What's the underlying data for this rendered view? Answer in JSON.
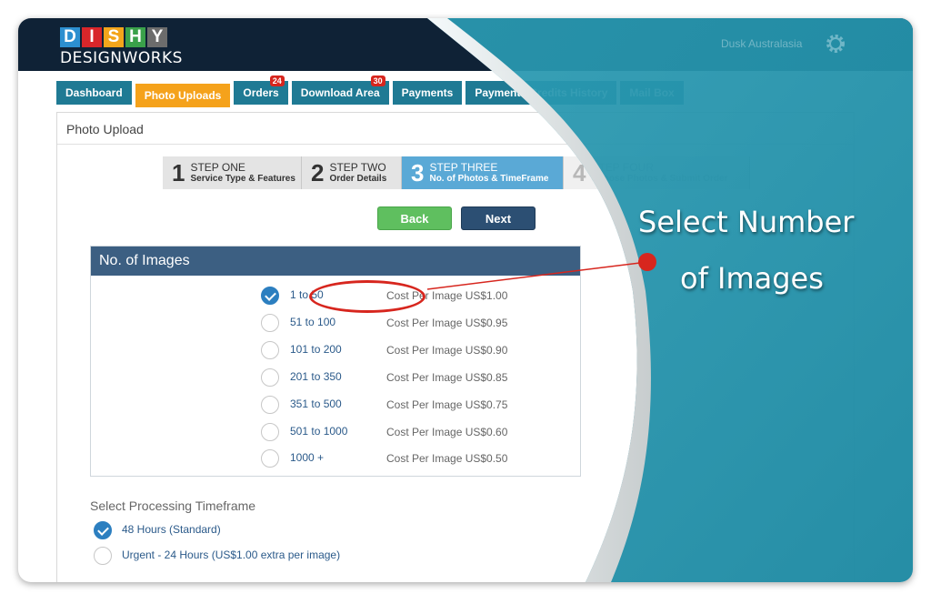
{
  "brand": {
    "letters": [
      "D",
      "I",
      "S",
      "H",
      "Y"
    ],
    "letter_colors": [
      "#2c8fd0",
      "#d8262a",
      "#f3a51b",
      "#3aa14a",
      "#6c6c6c"
    ],
    "subtitle": "DESIGNWORKS"
  },
  "header": {
    "user_name": "Dusk Australasia"
  },
  "tabs": [
    {
      "label": "Dashboard"
    },
    {
      "label": "Photo Uploads",
      "active": true
    },
    {
      "label": "Orders",
      "badge": "24"
    },
    {
      "label": "Download Area",
      "badge": "30"
    },
    {
      "label": "Payments"
    },
    {
      "label": "Payments/Credits History"
    },
    {
      "label": "Mail Box"
    }
  ],
  "panel": {
    "title": "Photo Upload"
  },
  "steps": [
    {
      "num": "1",
      "title": "STEP ONE",
      "subtitle": "Service Type & Features"
    },
    {
      "num": "2",
      "title": "STEP TWO",
      "subtitle": "Order Details"
    },
    {
      "num": "3",
      "title": "STEP THREE",
      "subtitle": "No. of Photos & TimeFrame"
    },
    {
      "num": "4",
      "title": "STEP FOUR",
      "subtitle": "Choose Photos & Submit Order"
    }
  ],
  "buttons": {
    "back": "Back",
    "next": "Next"
  },
  "images_box": {
    "title": "No. of Images",
    "options": [
      {
        "label": "1 to 50",
        "cost": "Cost Per Image US$1.00",
        "checked": true
      },
      {
        "label": "51 to 100",
        "cost": "Cost Per Image US$0.95"
      },
      {
        "label": "101 to 200",
        "cost": "Cost Per Image US$0.90"
      },
      {
        "label": "201 to 350",
        "cost": "Cost Per Image US$0.85"
      },
      {
        "label": "351 to 500",
        "cost": "Cost Per Image US$0.75"
      },
      {
        "label": "501 to 1000",
        "cost": "Cost Per Image US$0.60"
      },
      {
        "label": "1000 +",
        "cost": "Cost Per Image US$0.50"
      }
    ]
  },
  "processing": {
    "title": "Select Processing Timeframe",
    "options": [
      {
        "label": "48 Hours (Standard)",
        "checked": true
      },
      {
        "label": "Urgent - 24 Hours (US$1.00 extra per image)"
      }
    ]
  },
  "annotation": {
    "line1": "Select Number",
    "line2": "of Images"
  },
  "colors": {
    "header": "#0f2236",
    "tab": "#1f7a94",
    "tab_active": "#f5a21b",
    "box_header": "#3c5f82",
    "overlay_teal": "#2898b0",
    "annotation_red": "#d7261e"
  }
}
